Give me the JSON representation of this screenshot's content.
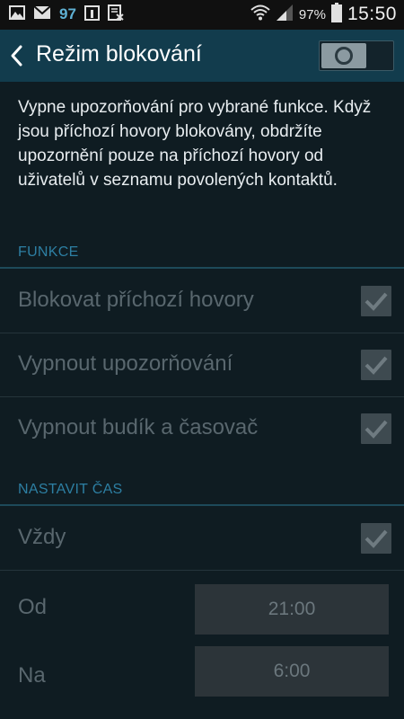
{
  "status_bar": {
    "notification_count": "97",
    "battery_percent": "97%",
    "time": "15:50",
    "icons": [
      "gallery-icon",
      "gmail-icon",
      "calendar-icon",
      "usb-debug-icon",
      "wifi-icon",
      "signal-icon",
      "battery-icon"
    ]
  },
  "header": {
    "title": "Režim blokování",
    "switch_on": false
  },
  "description": "Vypne upozorňování pro vybrané funkce. Když jsou příchozí hovory blokovány, obdržíte upozornění pouze na příchozí hovory od uživatelů v seznamu povolených kontaktů.",
  "sections": {
    "functions": {
      "header": "FUNKCE",
      "items": [
        {
          "label": "Blokovat příchozí hovory",
          "checked": true
        },
        {
          "label": "Vypnout upozorňování",
          "checked": true
        },
        {
          "label": "Vypnout budík a časovač",
          "checked": true
        }
      ]
    },
    "time": {
      "header": "NASTAVIT ČAS",
      "always_label": "Vždy",
      "always_checked": true,
      "from_label": "Od",
      "from_value": "21:00",
      "to_label": "Na",
      "to_value": "6:00"
    }
  },
  "colors": {
    "action_bar": "#123c4d",
    "background": "#0f1c22",
    "section_header": "#2d7fa3",
    "disabled_text": "#59676e"
  }
}
